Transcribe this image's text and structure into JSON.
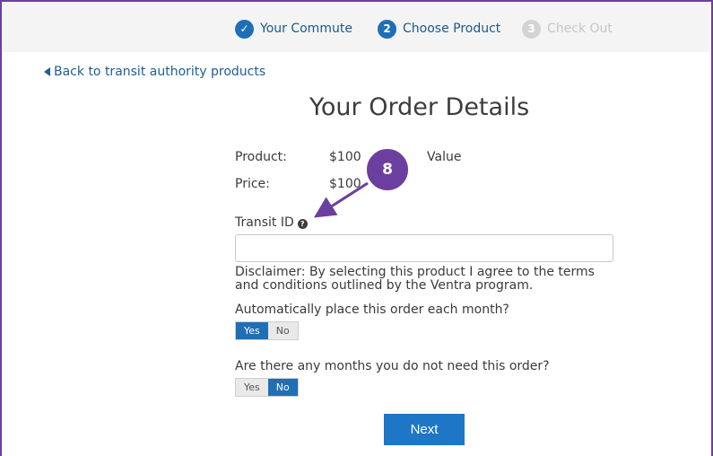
{
  "stepper": {
    "steps": [
      {
        "number": "✓",
        "label": "Your Commute",
        "state": "complete"
      },
      {
        "number": "2",
        "label": "Choose Product",
        "state": "active"
      },
      {
        "number": "3",
        "label": "Check Out",
        "state": "inactive"
      }
    ]
  },
  "nav": {
    "back_link": "Back to transit authority products"
  },
  "main": {
    "title": "Your Order Details",
    "product_label": "Product:",
    "product_value": "$100",
    "product_value_suffix": "Value",
    "price_label": "Price:",
    "price_value": "$100",
    "transit_id_label": "Transit ID",
    "transit_id_value": "",
    "transit_id_placeholder": "",
    "disclaimer": "Disclaimer: By selecting this product I agree to the terms and conditions outlined by the Ventra program.",
    "q1": "Automatically place this order each month?",
    "q1_yes": "Yes",
    "q1_no": "No",
    "q1_selected": "Yes",
    "q2": "Are there any months you do not need this order?",
    "q2_yes": "Yes",
    "q2_no": "No",
    "q2_selected": "No",
    "next_label": "Next"
  },
  "annotation": {
    "number": "8"
  },
  "colors": {
    "accent": "#1e6fb5",
    "annotation": "#6b3fa0",
    "inactive": "#d3d3d3"
  }
}
